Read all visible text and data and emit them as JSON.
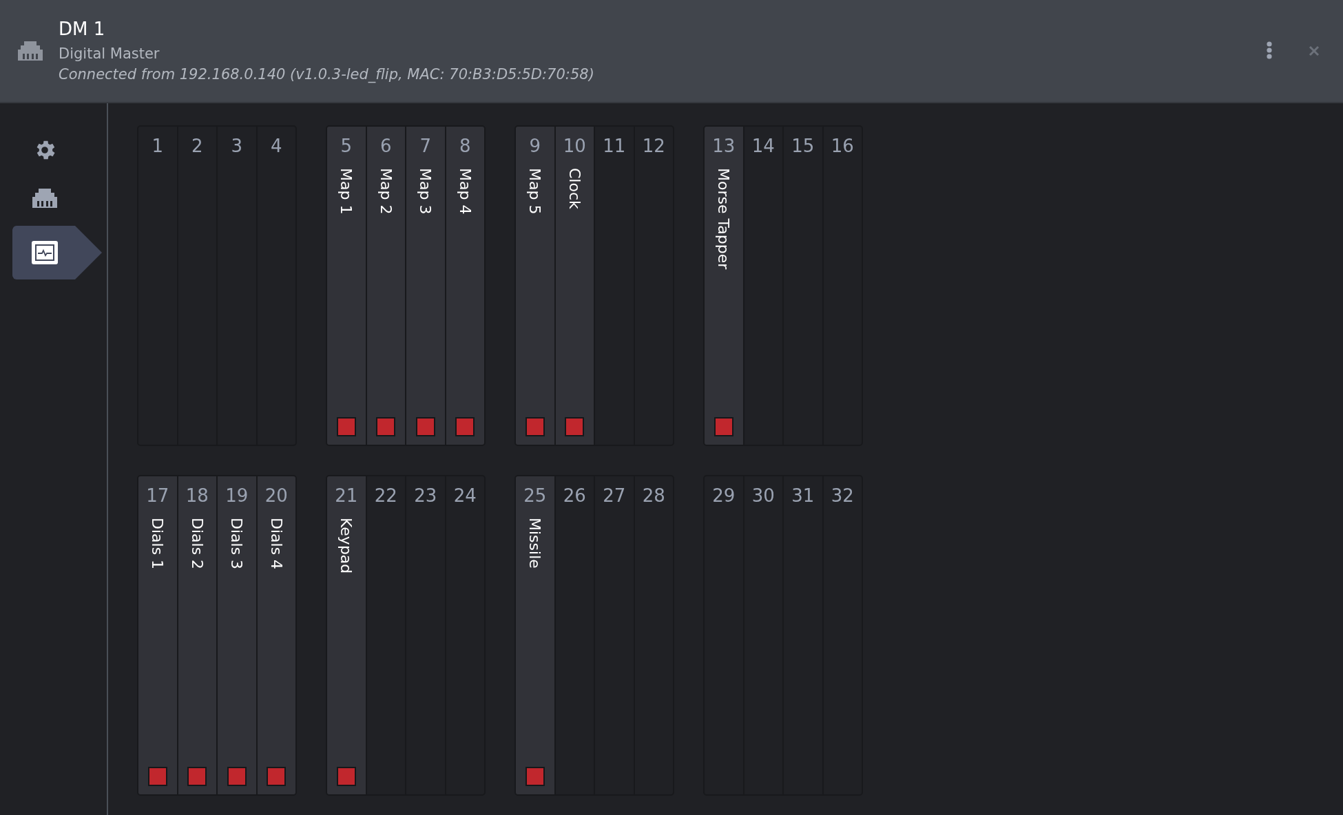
{
  "header": {
    "title": "DM 1",
    "subtitle": "Digital Master",
    "connection": "Connected from 192.168.0.140 (v1.0.3-led_flip, MAC: 70:B3:D5:5D:70:58)"
  },
  "sidebar": {
    "items": [
      {
        "kind": "settings",
        "selected": false
      },
      {
        "kind": "network",
        "selected": false
      },
      {
        "kind": "monitor",
        "selected": true
      }
    ]
  },
  "slot_rows": [
    [
      {
        "slots": [
          {
            "number": "1"
          },
          {
            "number": "2"
          },
          {
            "number": "3"
          },
          {
            "number": "4"
          }
        ]
      },
      {
        "slots": [
          {
            "number": "5",
            "label": "Map 1",
            "indicator": true
          },
          {
            "number": "6",
            "label": "Map 2",
            "indicator": true
          },
          {
            "number": "7",
            "label": "Map 3",
            "indicator": true
          },
          {
            "number": "8",
            "label": "Map 4",
            "indicator": true
          }
        ]
      },
      {
        "slots": [
          {
            "number": "9",
            "label": "Map 5",
            "indicator": true
          },
          {
            "number": "10",
            "label": "Clock",
            "indicator": true
          },
          {
            "number": "11"
          },
          {
            "number": "12"
          }
        ]
      },
      {
        "slots": [
          {
            "number": "13",
            "label": "Morse Tapper",
            "indicator": true
          },
          {
            "number": "14"
          },
          {
            "number": "15"
          },
          {
            "number": "16"
          }
        ]
      }
    ],
    [
      {
        "slots": [
          {
            "number": "17",
            "label": "Dials 1",
            "indicator": true
          },
          {
            "number": "18",
            "label": "Dials 2",
            "indicator": true
          },
          {
            "number": "19",
            "label": "Dials 3",
            "indicator": true
          },
          {
            "number": "20",
            "label": "Dials 4",
            "indicator": true
          }
        ]
      },
      {
        "slots": [
          {
            "number": "21",
            "label": "Keypad",
            "indicator": true
          },
          {
            "number": "22"
          },
          {
            "number": "23"
          },
          {
            "number": "24"
          }
        ]
      },
      {
        "slots": [
          {
            "number": "25",
            "label": "Missile",
            "indicator": true
          },
          {
            "number": "26"
          },
          {
            "number": "27"
          },
          {
            "number": "28"
          }
        ]
      },
      {
        "slots": [
          {
            "number": "29"
          },
          {
            "number": "30"
          },
          {
            "number": "31"
          },
          {
            "number": "32"
          }
        ]
      }
    ]
  ]
}
